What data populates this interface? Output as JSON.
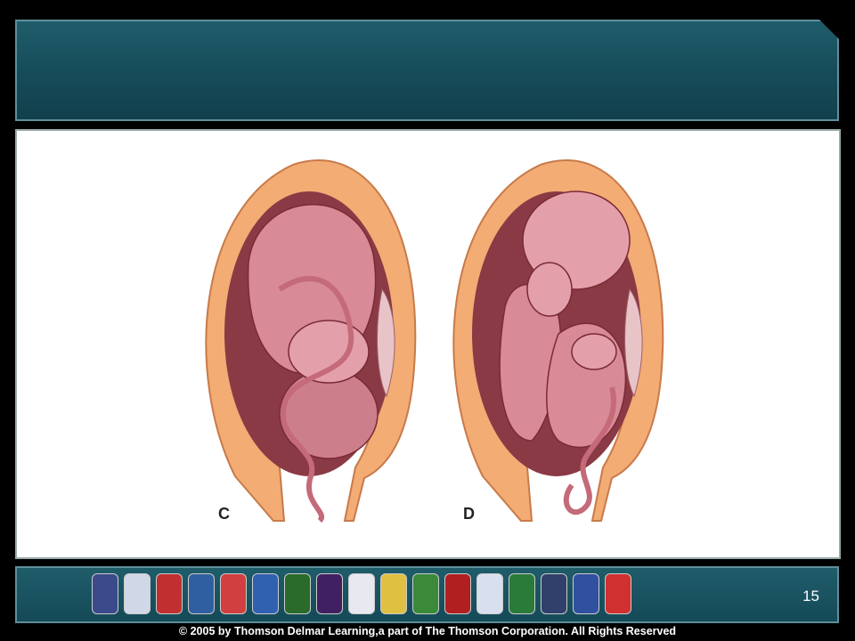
{
  "slide": {
    "page_number": "15",
    "copyright": "© 2005 by Thomson Delmar Learning,a part of The Thomson Corporation. All Rights Reserved"
  },
  "figure": {
    "panels": [
      {
        "label": "C"
      },
      {
        "label": "D"
      }
    ]
  },
  "footer": {
    "badges": [
      {
        "color": "#3a4a8a"
      },
      {
        "color": "#d0d8e8"
      },
      {
        "color": "#c03030"
      },
      {
        "color": "#2f5fa0"
      },
      {
        "color": "#d04040"
      },
      {
        "color": "#3060b0"
      },
      {
        "color": "#2a6a2a"
      },
      {
        "color": "#402060"
      },
      {
        "color": "#e8e8f0"
      },
      {
        "color": "#e0c040"
      },
      {
        "color": "#3a8a3a"
      },
      {
        "color": "#b02020"
      },
      {
        "color": "#d8e0f0"
      },
      {
        "color": "#2a7a3a"
      },
      {
        "color": "#30406a"
      },
      {
        "color": "#3050a0"
      },
      {
        "color": "#d03030"
      }
    ]
  }
}
